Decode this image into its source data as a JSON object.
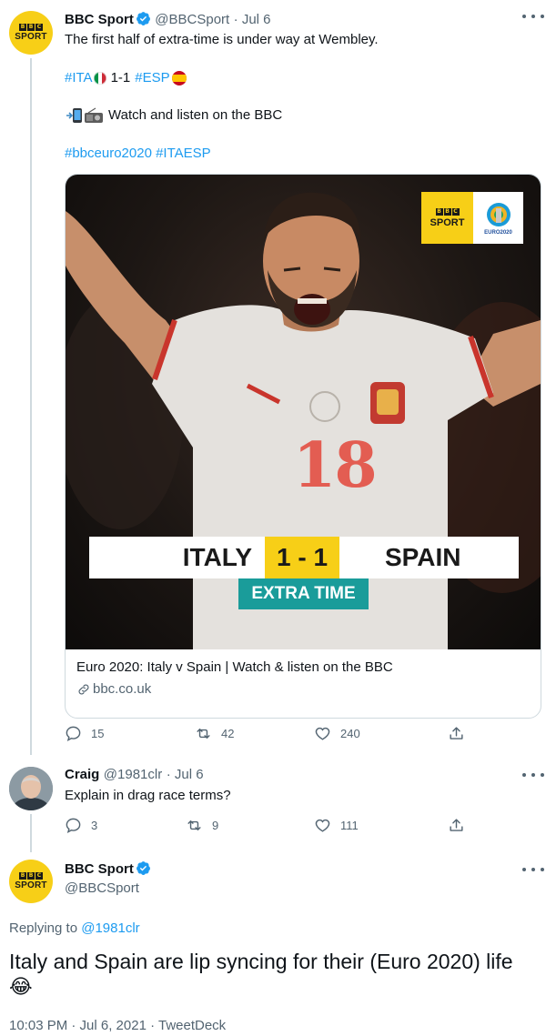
{
  "tweet1": {
    "name": "BBC Sport",
    "handle": "@BBCSport",
    "time": "· Jul 6",
    "line1": "The first half of extra-time is under way at Wembley.",
    "tag_ita": "#ITA",
    "score": "1-1",
    "tag_esp": "#ESP",
    "watch": "Watch and listen on the BBC",
    "tags": "#bbceuro2020 #ITAESP",
    "card": {
      "team_home": "ITALY",
      "score": "1 - 1",
      "team_away": "SPAIN",
      "status": "EXTRA TIME",
      "shirt_number": "18",
      "badge_bbc": "BBC",
      "badge_sport": "SPORT",
      "badge_euro": "EURO2020",
      "title": "Euro 2020: Italy v Spain | Watch & listen on the BBC",
      "domain": "bbc.co.uk"
    },
    "replies": "15",
    "retweets": "42",
    "likes": "240"
  },
  "tweet2": {
    "name": "Craig",
    "handle": "@1981clr",
    "time": "· Jul 6",
    "text": "Explain in drag race terms?",
    "replies": "3",
    "retweets": "9",
    "likes": "111"
  },
  "tweet3": {
    "name": "BBC Sport",
    "handle": "@BBCSport",
    "replying_prefix": "Replying to",
    "replying_to": "@1981clr",
    "text": "Italy and Spain are lip syncing for their (Euro 2020) life",
    "emoji": "😂",
    "meta": "10:03 PM · Jul 6, 2021 · TweetDeck"
  },
  "avatar_labels": {
    "bbc": "BBC",
    "sport": "SPORT"
  },
  "colors": {
    "accent": "#1d9bf0",
    "bbc_yellow": "#f7cf17",
    "extra_time_teal": "#1a9c9a",
    "muted": "#536471"
  }
}
